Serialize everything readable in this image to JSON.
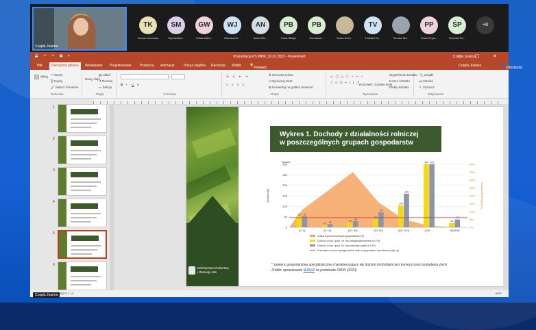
{
  "meeting": {
    "self_name": "Czapla Joanna",
    "participants": [
      {
        "initials": "TK",
        "name": "Teresa Kurowska",
        "color": "#e9dfb7"
      },
      {
        "initials": "SM",
        "name": "Szymańska...",
        "color": "#d8d0ea"
      },
      {
        "initials": "GW",
        "name": "Gulaa Walcl...",
        "color": "#f0d2dc"
      },
      {
        "initials": "WJ",
        "name": "Wiśniewski ...",
        "color": "#cfe3f6"
      },
      {
        "initials": "AN",
        "name": "Adam Nie...",
        "color": "#d4dde6"
      },
      {
        "initials": "PB",
        "name": "Paweł Błajer",
        "color": "#d8eed0"
      },
      {
        "initials": "PB",
        "name": "Pomianek...",
        "color": "#d8eed0"
      },
      {
        "initials": "",
        "name": "Aneta Such...",
        "color": "#c9b89a"
      },
      {
        "initials": "TV",
        "name": "Trinidad Va...",
        "color": "#cfe3f6"
      },
      {
        "initials": "",
        "name": "Tomasz Ma...",
        "color": "#9aa4b0"
      },
      {
        "initials": "PP",
        "name": "Paweł Popa...",
        "color": "#f0d2dc"
      },
      {
        "initials": "ŚP",
        "name": "Ścieński Pa...",
        "color": "#d8eed0"
      }
    ],
    "more_label": "+8"
  },
  "app": {
    "title": "Prezentacja PS WPR_10.01.2023 - PowerPoint",
    "user": "Czapla Joanna",
    "share": "Udostępnij",
    "tabs": [
      "Plik",
      "Narzędzia główne",
      "Wstawianie",
      "Projektowanie",
      "Przejścia",
      "Animacje",
      "Pokaz slajdów",
      "Recenzja",
      "Widok"
    ],
    "active_tab_index": 1,
    "tell_me": "Powiedz mi, co chcesz zrobić..."
  },
  "ribbon": {
    "clipboard": {
      "cut": "Wytnij",
      "copy": "Kopiuj",
      "format_painter": "Malarz formatów",
      "paste": "Wklej",
      "label": "Schowek"
    },
    "slides": {
      "new_slide": "Nowy slajd",
      "layout": "Układ",
      "reset": "Resetuj",
      "section": "Sekcja",
      "label": "Slajdy"
    },
    "font": {
      "label": "Czcionka",
      "style_buttons": [
        "B",
        "I",
        "U",
        "S"
      ]
    },
    "paragraph": {
      "direction": "Kierunek tekstu",
      "align": "Wyrównaj tekst",
      "smartart": "Konwertuj na grafikę SmartArt",
      "label": "Akapit"
    },
    "drawing": {
      "arrange": "Rozmieść",
      "quick_styles": "Szybkie style",
      "fill": "Wypełnienie kształtu",
      "outline": "Kontur kształtu",
      "effects": "Efekty kształtu",
      "label": "Rysowanie"
    },
    "editing": {
      "find": "Znajdź",
      "replace": "Zamień",
      "select": "Zaznacz",
      "label": "Edytowanie"
    }
  },
  "slides_pane": {
    "numbers": [
      "1",
      "2",
      "3",
      "4",
      "5",
      "6"
    ],
    "selected": "5"
  },
  "slide": {
    "title_line1": "Wykres 1. Dochody z działalności rolniczej",
    "title_line2": "w poszczególnych grupach gospodarstw",
    "ministry_line1": "Ministerstwo Rolnictwa",
    "ministry_line2": "i Rozwoju Wsi",
    "footnote": "* zawiera gospodarstwa specjalistyczne charakteryzujące się dużymi dochodami bez konieczności posiadania ziemi",
    "source_prefix": "Źródło: opracowanie ",
    "source_link": "IERiGŻ",
    "source_suffix": " na podstawie FADN (2020)"
  },
  "chart_data": {
    "type": "bar",
    "categories": [
      "(0; 5)",
      "[5; 10)",
      "[10; 30)",
      "[30; 50)",
      "[50; 100)",
      "[100; ...",
      "RAZEM"
    ],
    "ylabel_left": "dochód [zł]",
    "ylabel_left_units": "Tysiące",
    "ylim": [
      0,
      300
    ],
    "yticks": [
      0,
      50,
      100,
      150,
      200,
      250,
      300
    ],
    "ylabel_right": "% liczby gospodarstw",
    "y2lim": [
      0,
      40
    ],
    "y2ticks": [
      "0%",
      "5%",
      "10%",
      "15%",
      "20%",
      "25%",
      "30%",
      "35%",
      "40%"
    ],
    "series": [
      {
        "name": "Dochód z rodz. gosp. rol. bez dotacji/zatrudnienie w UTW",
        "color": "#f5d712",
        "values": [
          52,
          10,
          23,
          38,
          104,
          300,
          21
        ]
      },
      {
        "name": "Dochód z rodz. gosp. rol. wg rozwinięć rassel w UTW",
        "color": "#8d96a6",
        "values": [
          52,
          15,
          30,
          73,
          160,
          300,
          37
        ]
      },
      {
        "name": "Udział reprezentowanych gospodarstw [%]",
        "color": "#f4a460",
        "type": "area",
        "values": [
          11,
          23,
          35,
          16,
          5,
          1,
          0
        ]
      }
    ],
    "reference_line": {
      "name": "Przeciętne roczne wynagrodzenie netto w gospodarce narodowej w [tys.zł]",
      "color": "#c0392b",
      "value": 46
    },
    "data_labels": [
      "52",
      "52",
      "10",
      "15",
      "23",
      "30",
      "38",
      "73",
      "104",
      "160",
      "21",
      "37"
    ]
  },
  "status": {
    "slide_info": "Slajd 5 z 14",
    "zoom": "64%"
  }
}
